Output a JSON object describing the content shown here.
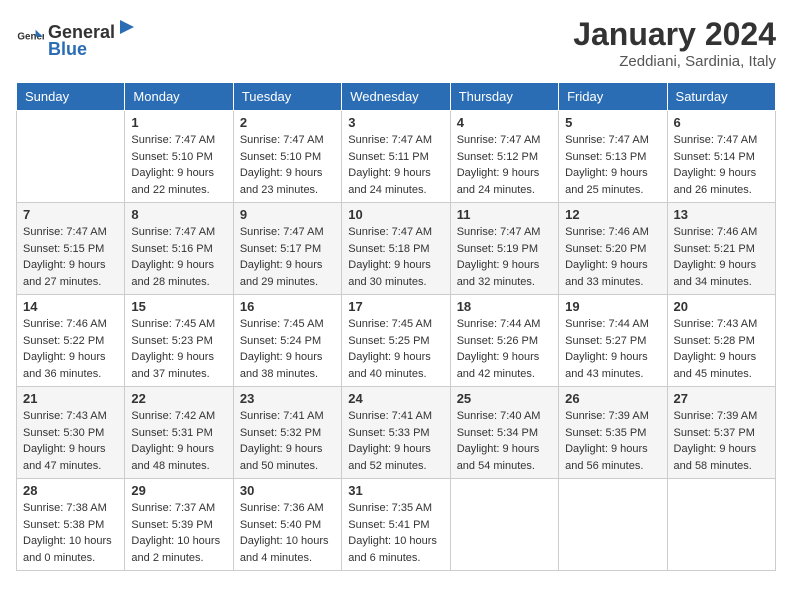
{
  "header": {
    "logo_general": "General",
    "logo_blue": "Blue",
    "month": "January 2024",
    "location": "Zeddiani, Sardinia, Italy"
  },
  "days_of_week": [
    "Sunday",
    "Monday",
    "Tuesday",
    "Wednesday",
    "Thursday",
    "Friday",
    "Saturday"
  ],
  "weeks": [
    [
      {
        "day": "",
        "sunrise": "",
        "sunset": "",
        "daylight": ""
      },
      {
        "day": "1",
        "sunrise": "7:47 AM",
        "sunset": "5:10 PM",
        "daylight": "9 hours and 22 minutes."
      },
      {
        "day": "2",
        "sunrise": "7:47 AM",
        "sunset": "5:10 PM",
        "daylight": "9 hours and 23 minutes."
      },
      {
        "day": "3",
        "sunrise": "7:47 AM",
        "sunset": "5:11 PM",
        "daylight": "9 hours and 24 minutes."
      },
      {
        "day": "4",
        "sunrise": "7:47 AM",
        "sunset": "5:12 PM",
        "daylight": "9 hours and 24 minutes."
      },
      {
        "day": "5",
        "sunrise": "7:47 AM",
        "sunset": "5:13 PM",
        "daylight": "9 hours and 25 minutes."
      },
      {
        "day": "6",
        "sunrise": "7:47 AM",
        "sunset": "5:14 PM",
        "daylight": "9 hours and 26 minutes."
      }
    ],
    [
      {
        "day": "7",
        "sunrise": "7:47 AM",
        "sunset": "5:15 PM",
        "daylight": "9 hours and 27 minutes."
      },
      {
        "day": "8",
        "sunrise": "7:47 AM",
        "sunset": "5:16 PM",
        "daylight": "9 hours and 28 minutes."
      },
      {
        "day": "9",
        "sunrise": "7:47 AM",
        "sunset": "5:17 PM",
        "daylight": "9 hours and 29 minutes."
      },
      {
        "day": "10",
        "sunrise": "7:47 AM",
        "sunset": "5:18 PM",
        "daylight": "9 hours and 30 minutes."
      },
      {
        "day": "11",
        "sunrise": "7:47 AM",
        "sunset": "5:19 PM",
        "daylight": "9 hours and 32 minutes."
      },
      {
        "day": "12",
        "sunrise": "7:46 AM",
        "sunset": "5:20 PM",
        "daylight": "9 hours and 33 minutes."
      },
      {
        "day": "13",
        "sunrise": "7:46 AM",
        "sunset": "5:21 PM",
        "daylight": "9 hours and 34 minutes."
      }
    ],
    [
      {
        "day": "14",
        "sunrise": "7:46 AM",
        "sunset": "5:22 PM",
        "daylight": "9 hours and 36 minutes."
      },
      {
        "day": "15",
        "sunrise": "7:45 AM",
        "sunset": "5:23 PM",
        "daylight": "9 hours and 37 minutes."
      },
      {
        "day": "16",
        "sunrise": "7:45 AM",
        "sunset": "5:24 PM",
        "daylight": "9 hours and 38 minutes."
      },
      {
        "day": "17",
        "sunrise": "7:45 AM",
        "sunset": "5:25 PM",
        "daylight": "9 hours and 40 minutes."
      },
      {
        "day": "18",
        "sunrise": "7:44 AM",
        "sunset": "5:26 PM",
        "daylight": "9 hours and 42 minutes."
      },
      {
        "day": "19",
        "sunrise": "7:44 AM",
        "sunset": "5:27 PM",
        "daylight": "9 hours and 43 minutes."
      },
      {
        "day": "20",
        "sunrise": "7:43 AM",
        "sunset": "5:28 PM",
        "daylight": "9 hours and 45 minutes."
      }
    ],
    [
      {
        "day": "21",
        "sunrise": "7:43 AM",
        "sunset": "5:30 PM",
        "daylight": "9 hours and 47 minutes."
      },
      {
        "day": "22",
        "sunrise": "7:42 AM",
        "sunset": "5:31 PM",
        "daylight": "9 hours and 48 minutes."
      },
      {
        "day": "23",
        "sunrise": "7:41 AM",
        "sunset": "5:32 PM",
        "daylight": "9 hours and 50 minutes."
      },
      {
        "day": "24",
        "sunrise": "7:41 AM",
        "sunset": "5:33 PM",
        "daylight": "9 hours and 52 minutes."
      },
      {
        "day": "25",
        "sunrise": "7:40 AM",
        "sunset": "5:34 PM",
        "daylight": "9 hours and 54 minutes."
      },
      {
        "day": "26",
        "sunrise": "7:39 AM",
        "sunset": "5:35 PM",
        "daylight": "9 hours and 56 minutes."
      },
      {
        "day": "27",
        "sunrise": "7:39 AM",
        "sunset": "5:37 PM",
        "daylight": "9 hours and 58 minutes."
      }
    ],
    [
      {
        "day": "28",
        "sunrise": "7:38 AM",
        "sunset": "5:38 PM",
        "daylight": "10 hours and 0 minutes."
      },
      {
        "day": "29",
        "sunrise": "7:37 AM",
        "sunset": "5:39 PM",
        "daylight": "10 hours and 2 minutes."
      },
      {
        "day": "30",
        "sunrise": "7:36 AM",
        "sunset": "5:40 PM",
        "daylight": "10 hours and 4 minutes."
      },
      {
        "day": "31",
        "sunrise": "7:35 AM",
        "sunset": "5:41 PM",
        "daylight": "10 hours and 6 minutes."
      },
      {
        "day": "",
        "sunrise": "",
        "sunset": "",
        "daylight": ""
      },
      {
        "day": "",
        "sunrise": "",
        "sunset": "",
        "daylight": ""
      },
      {
        "day": "",
        "sunrise": "",
        "sunset": "",
        "daylight": ""
      }
    ]
  ],
  "labels": {
    "sunrise_prefix": "Sunrise: ",
    "sunset_prefix": "Sunset: ",
    "daylight_prefix": "Daylight: "
  }
}
